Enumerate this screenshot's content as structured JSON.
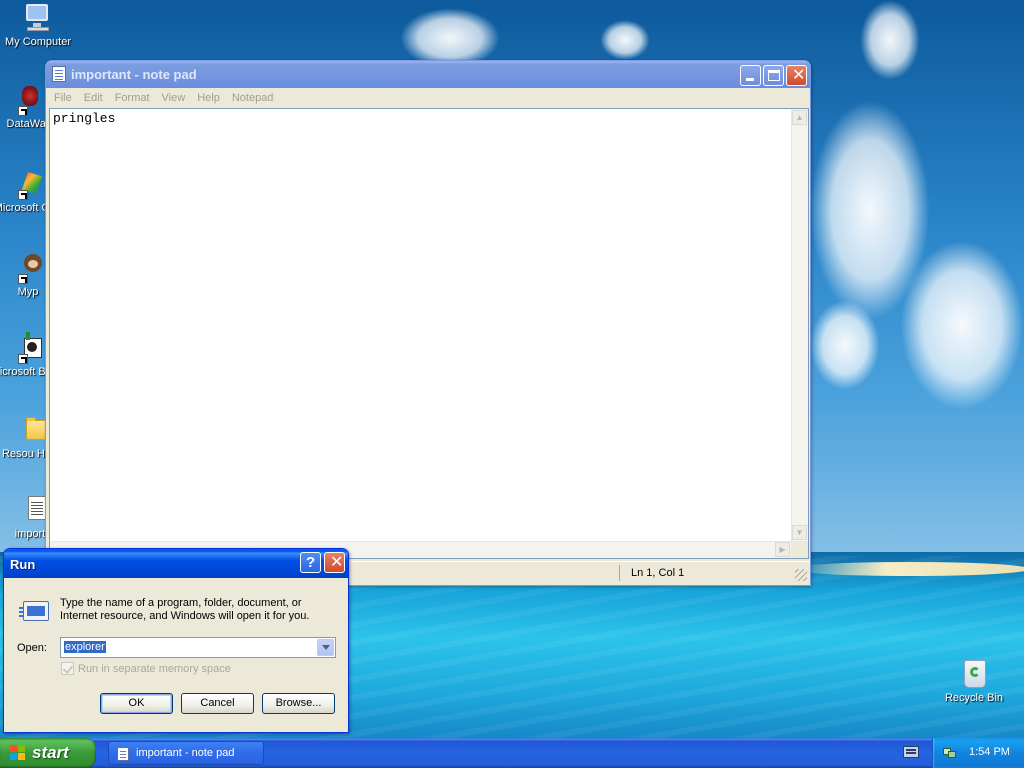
{
  "desktop": {
    "icons": [
      {
        "label": "My Computer"
      },
      {
        "label": "DataWar"
      },
      {
        "label": "Microsoft C++"
      },
      {
        "label": "Myp"
      },
      {
        "label": "Microsoft Basic"
      },
      {
        "label": "Resou Hack"
      },
      {
        "label": "import"
      },
      {
        "label": "Recycle Bin"
      }
    ]
  },
  "notepad": {
    "title": "important - note pad",
    "menu": [
      "File",
      "Edit",
      "Format",
      "View",
      "Help",
      "Notepad"
    ],
    "content": "pringles",
    "status_position": "Ln 1, Col 1"
  },
  "run_dialog": {
    "title": "Run",
    "help_glyph": "?",
    "description": "Type the name of a program, folder, document, or Internet resource, and Windows will open it for you.",
    "open_label": "Open:",
    "open_value": "explorer",
    "checkbox_label": "Run in separate memory space",
    "buttons": {
      "ok": "OK",
      "cancel": "Cancel",
      "browse": "Browse..."
    }
  },
  "taskbar": {
    "start_label": "start",
    "items": [
      {
        "label": "important - note pad"
      }
    ],
    "clock": "1:54 PM"
  },
  "colors": {
    "xp_blue_title": "#0054e3",
    "start_green": "#3a9a3a",
    "tray_blue": "#1184e0",
    "selection": "#316ac5"
  }
}
